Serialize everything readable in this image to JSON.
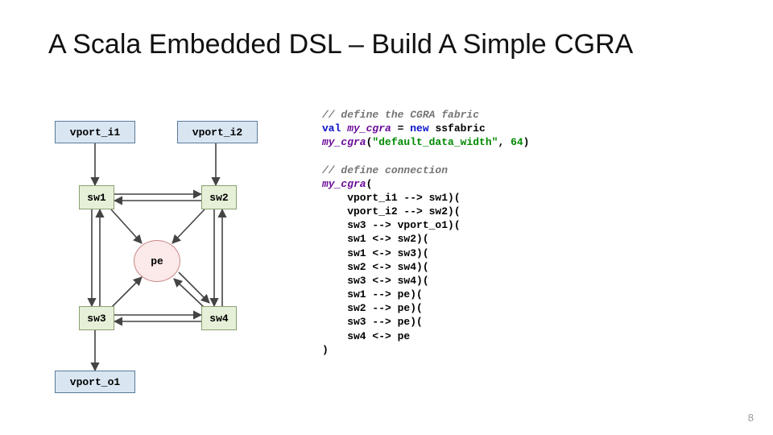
{
  "title": "A Scala Embedded DSL – Build A Simple CGRA",
  "diagram": {
    "vport_i1": "vport_i1",
    "vport_i2": "vport_i2",
    "vport_o1": "vport_o1",
    "sw1": "sw1",
    "sw2": "sw2",
    "sw3": "sw3",
    "sw4": "sw4",
    "pe": "pe"
  },
  "code": {
    "c1": "// define the CGRA fabric",
    "kw_val": "val",
    "id_mycgra": "my_cgra",
    "eq": " = ",
    "kw_new": "new",
    "sp": " ",
    "ssfabric": "ssfabric",
    "call_open": "(",
    "str_ddw": "\"default_data_width\"",
    "comma": ", ",
    "num_64": "64",
    "call_close": ")",
    "c2": "// define connection",
    "l_open": "my_cgra(",
    "l1": "    vport_i1 --> sw1)(",
    "l2": "    vport_i2 --> sw2)(",
    "l3": "    sw3 --> vport_o1)(",
    "l4": "    sw1 <-> sw2)(",
    "l5": "    sw1 <-> sw3)(",
    "l6": "    sw2 <-> sw4)(",
    "l7": "    sw3 <-> sw4)(",
    "l8": "    sw1 --> pe)(",
    "l9": "    sw2 --> pe)(",
    "l10": "    sw3 --> pe)(",
    "l11": "    sw4 <-> pe",
    "l_close": ")"
  },
  "page_number": "8"
}
